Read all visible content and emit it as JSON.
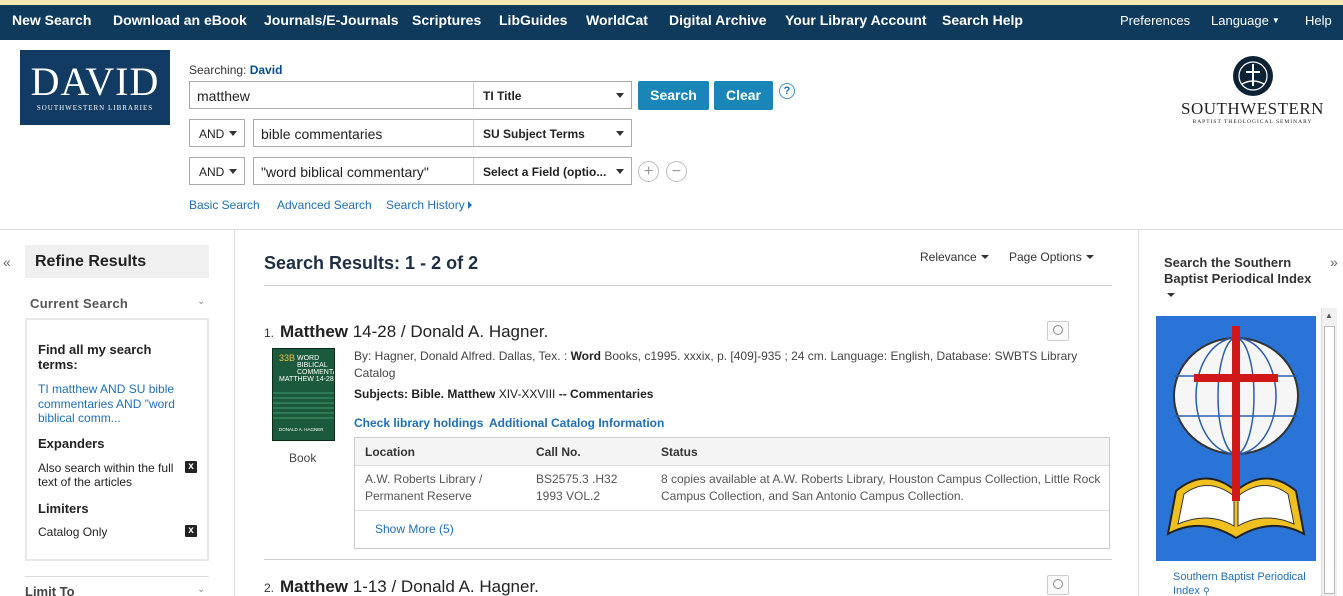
{
  "topnav": {
    "items": [
      "New Search",
      "Download an eBook",
      "Journals/E-Journals",
      "Scriptures",
      "LibGuides",
      "WorldCat",
      "Digital Archive",
      "Your Library Account",
      "Search Help"
    ],
    "right": [
      "Preferences",
      "Language",
      "Help"
    ]
  },
  "logo": {
    "big": "DAVID",
    "small": "SOUTHWESTERN LIBRARIES"
  },
  "search": {
    "searching_label": "Searching:",
    "database": "David",
    "rows": [
      {
        "bool": "",
        "value": "matthew",
        "field": "TI Title"
      },
      {
        "bool": "AND",
        "value": "bible commentaries",
        "field": "SU Subject Terms"
      },
      {
        "bool": "AND",
        "value": "\"word biblical commentary\"",
        "field": "Select a Field (optio..."
      }
    ],
    "search_btn": "Search",
    "clear_btn": "Clear",
    "help": "?",
    "add": "+",
    "remove": "−",
    "links": [
      "Basic Search",
      "Advanced Search",
      "Search History"
    ]
  },
  "brand": {
    "name": "SOUTHWESTERN",
    "sub": "BAPTIST THEOLOGICAL SEMINARY"
  },
  "left": {
    "collapse": "«",
    "refine": "Refine Results",
    "current_search": "Current Search",
    "find_all": "Find all my search terms:",
    "query": "TI matthew AND SU bible commentaries AND \"word biblical comm...",
    "expanders_title": "Expanders",
    "expander": "Also search within the full text of the articles",
    "limiters_title": "Limiters",
    "limiter": "Catalog Only",
    "remove_x": "x",
    "limit_to": "Limit To"
  },
  "results": {
    "title": "Search Results: 1 - 2 of 2",
    "sort": "Relevance",
    "page_options": "Page Options",
    "items": [
      {
        "num": "1.",
        "title_bold": "Matthew",
        "title_rest": " 14-28 / Donald A. Hagner.",
        "by_prefix": "By: Hagner, Donald Alfred. Dallas, Tex. : ",
        "by_bold": "Word",
        "by_rest": " Books, c1995. xxxix, p. [409]-935 ; 24 cm. Language: English, Database: SWBTS Library Catalog",
        "subjects_label": "Subjects: Bible. ",
        "subjects_bold": "Matthew",
        "subjects_mid": " XIV-XXVIII",
        "subjects_rest": " -- Commentaries",
        "cover_vol": "33B",
        "cover_title": "WORD BIBLICAL COMMENTARY",
        "cover_sub": "MATTHEW 14-28",
        "cover_author": "DONALD A. HAGNER",
        "type": "Book",
        "links": [
          "Check library holdings",
          "Additional Catalog Information"
        ],
        "holdings": {
          "headers": [
            "Location",
            "Call No.",
            "Status"
          ],
          "location": "A.W. Roberts Library / Permanent Reserve",
          "callno": "BS2575.3 .H32 1993 VOL.2",
          "status": "8 copies available at A.W. Roberts Library, Houston Campus Collection, Little Rock Campus Collection, and San Antonio Campus Collection.",
          "show_more": "Show More (5)"
        }
      },
      {
        "num": "2.",
        "title_bold": "Matthew",
        "title_rest": " 1-13 / Donald A. Hagner."
      }
    ]
  },
  "right": {
    "collapse": "»",
    "title": "Search the Southern Baptist Periodical Index",
    "link": "Southern Baptist Periodical Index"
  }
}
